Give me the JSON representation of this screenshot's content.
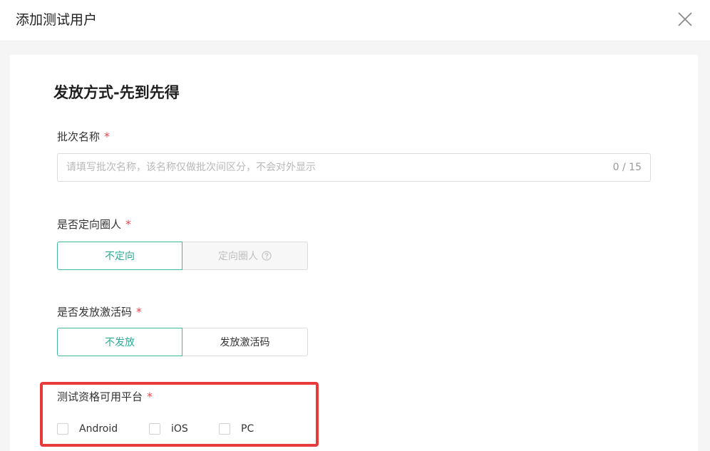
{
  "dialog": {
    "title": "添加测试用户"
  },
  "section": {
    "title": "发放方式-先到先得"
  },
  "batch_name": {
    "label": "批次名称",
    "required_mark": "*",
    "placeholder": "请填写批次名称，该名称仅做批次间区分，不会对外显示",
    "value": "",
    "counter": "0 / 15"
  },
  "targeting": {
    "label": "是否定向圈人",
    "required_mark": "*",
    "options": [
      "不定向",
      "定向圈人"
    ],
    "selected": "不定向"
  },
  "activation_code": {
    "label": "是否发放激活码",
    "required_mark": "*",
    "options": [
      "不发放",
      "发放激活码"
    ],
    "selected": "不发放"
  },
  "platforms": {
    "label": "测试资格可用平台",
    "required_mark": "*",
    "options": [
      "Android",
      "iOS",
      "PC"
    ],
    "checked": []
  },
  "colors": {
    "accent": "#3fb8a5",
    "required": "#e0474c",
    "highlight": "#e8393b"
  },
  "icons": {
    "close": "close-icon",
    "help": "question-circle-icon"
  }
}
